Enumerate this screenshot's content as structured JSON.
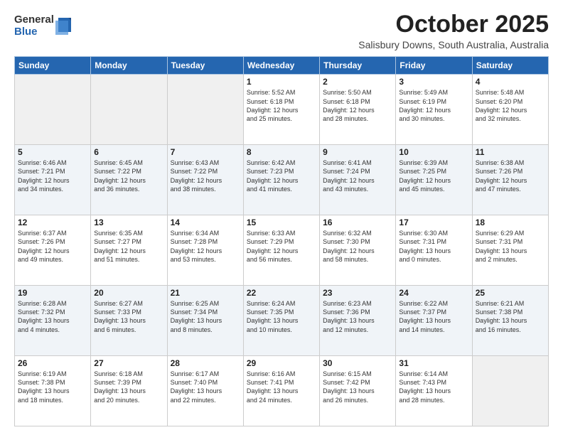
{
  "logo": {
    "general": "General",
    "blue": "Blue"
  },
  "title": "October 2025",
  "location": "Salisbury Downs, South Australia, Australia",
  "days_of_week": [
    "Sunday",
    "Monday",
    "Tuesday",
    "Wednesday",
    "Thursday",
    "Friday",
    "Saturday"
  ],
  "weeks": [
    [
      {
        "day": "",
        "info": ""
      },
      {
        "day": "",
        "info": ""
      },
      {
        "day": "",
        "info": ""
      },
      {
        "day": "1",
        "info": "Sunrise: 5:52 AM\nSunset: 6:18 PM\nDaylight: 12 hours\nand 25 minutes."
      },
      {
        "day": "2",
        "info": "Sunrise: 5:50 AM\nSunset: 6:18 PM\nDaylight: 12 hours\nand 28 minutes."
      },
      {
        "day": "3",
        "info": "Sunrise: 5:49 AM\nSunset: 6:19 PM\nDaylight: 12 hours\nand 30 minutes."
      },
      {
        "day": "4",
        "info": "Sunrise: 5:48 AM\nSunset: 6:20 PM\nDaylight: 12 hours\nand 32 minutes."
      }
    ],
    [
      {
        "day": "5",
        "info": "Sunrise: 6:46 AM\nSunset: 7:21 PM\nDaylight: 12 hours\nand 34 minutes."
      },
      {
        "day": "6",
        "info": "Sunrise: 6:45 AM\nSunset: 7:22 PM\nDaylight: 12 hours\nand 36 minutes."
      },
      {
        "day": "7",
        "info": "Sunrise: 6:43 AM\nSunset: 7:22 PM\nDaylight: 12 hours\nand 38 minutes."
      },
      {
        "day": "8",
        "info": "Sunrise: 6:42 AM\nSunset: 7:23 PM\nDaylight: 12 hours\nand 41 minutes."
      },
      {
        "day": "9",
        "info": "Sunrise: 6:41 AM\nSunset: 7:24 PM\nDaylight: 12 hours\nand 43 minutes."
      },
      {
        "day": "10",
        "info": "Sunrise: 6:39 AM\nSunset: 7:25 PM\nDaylight: 12 hours\nand 45 minutes."
      },
      {
        "day": "11",
        "info": "Sunrise: 6:38 AM\nSunset: 7:26 PM\nDaylight: 12 hours\nand 47 minutes."
      }
    ],
    [
      {
        "day": "12",
        "info": "Sunrise: 6:37 AM\nSunset: 7:26 PM\nDaylight: 12 hours\nand 49 minutes."
      },
      {
        "day": "13",
        "info": "Sunrise: 6:35 AM\nSunset: 7:27 PM\nDaylight: 12 hours\nand 51 minutes."
      },
      {
        "day": "14",
        "info": "Sunrise: 6:34 AM\nSunset: 7:28 PM\nDaylight: 12 hours\nand 53 minutes."
      },
      {
        "day": "15",
        "info": "Sunrise: 6:33 AM\nSunset: 7:29 PM\nDaylight: 12 hours\nand 56 minutes."
      },
      {
        "day": "16",
        "info": "Sunrise: 6:32 AM\nSunset: 7:30 PM\nDaylight: 12 hours\nand 58 minutes."
      },
      {
        "day": "17",
        "info": "Sunrise: 6:30 AM\nSunset: 7:31 PM\nDaylight: 13 hours\nand 0 minutes."
      },
      {
        "day": "18",
        "info": "Sunrise: 6:29 AM\nSunset: 7:31 PM\nDaylight: 13 hours\nand 2 minutes."
      }
    ],
    [
      {
        "day": "19",
        "info": "Sunrise: 6:28 AM\nSunset: 7:32 PM\nDaylight: 13 hours\nand 4 minutes."
      },
      {
        "day": "20",
        "info": "Sunrise: 6:27 AM\nSunset: 7:33 PM\nDaylight: 13 hours\nand 6 minutes."
      },
      {
        "day": "21",
        "info": "Sunrise: 6:25 AM\nSunset: 7:34 PM\nDaylight: 13 hours\nand 8 minutes."
      },
      {
        "day": "22",
        "info": "Sunrise: 6:24 AM\nSunset: 7:35 PM\nDaylight: 13 hours\nand 10 minutes."
      },
      {
        "day": "23",
        "info": "Sunrise: 6:23 AM\nSunset: 7:36 PM\nDaylight: 13 hours\nand 12 minutes."
      },
      {
        "day": "24",
        "info": "Sunrise: 6:22 AM\nSunset: 7:37 PM\nDaylight: 13 hours\nand 14 minutes."
      },
      {
        "day": "25",
        "info": "Sunrise: 6:21 AM\nSunset: 7:38 PM\nDaylight: 13 hours\nand 16 minutes."
      }
    ],
    [
      {
        "day": "26",
        "info": "Sunrise: 6:19 AM\nSunset: 7:38 PM\nDaylight: 13 hours\nand 18 minutes."
      },
      {
        "day": "27",
        "info": "Sunrise: 6:18 AM\nSunset: 7:39 PM\nDaylight: 13 hours\nand 20 minutes."
      },
      {
        "day": "28",
        "info": "Sunrise: 6:17 AM\nSunset: 7:40 PM\nDaylight: 13 hours\nand 22 minutes."
      },
      {
        "day": "29",
        "info": "Sunrise: 6:16 AM\nSunset: 7:41 PM\nDaylight: 13 hours\nand 24 minutes."
      },
      {
        "day": "30",
        "info": "Sunrise: 6:15 AM\nSunset: 7:42 PM\nDaylight: 13 hours\nand 26 minutes."
      },
      {
        "day": "31",
        "info": "Sunrise: 6:14 AM\nSunset: 7:43 PM\nDaylight: 13 hours\nand 28 minutes."
      },
      {
        "day": "",
        "info": ""
      }
    ]
  ]
}
